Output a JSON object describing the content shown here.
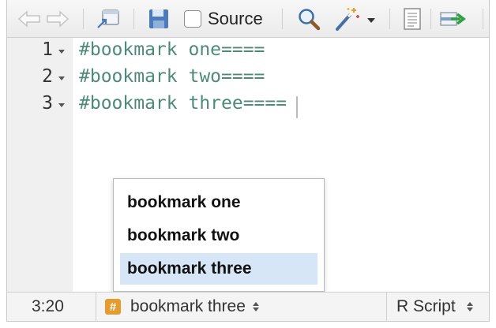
{
  "toolbar": {
    "source_label": "Source",
    "source_checked": false,
    "icons": [
      "back-arrow-icon",
      "forward-arrow-icon",
      "show-in-window-icon",
      "save-icon",
      "find-icon",
      "magic-wand-icon",
      "compile-report-icon",
      "run-icon"
    ]
  },
  "editor": {
    "lines": [
      {
        "number": "1",
        "text": "#bookmark one===="
      },
      {
        "number": "2",
        "text": "#bookmark two===="
      },
      {
        "number": "3",
        "text": "#bookmark three===="
      }
    ],
    "code_color": "#4d8a7a"
  },
  "popup": {
    "items": [
      {
        "label": "bookmark one",
        "selected": false
      },
      {
        "label": "bookmark two",
        "selected": false
      },
      {
        "label": "bookmark three",
        "selected": true
      }
    ],
    "selection_color": "#d6e6f7"
  },
  "status": {
    "position": "3:20",
    "section_icon_glyph": "#",
    "section_label": "bookmark three",
    "file_type": "R Script",
    "accent": "#e59b2d"
  }
}
